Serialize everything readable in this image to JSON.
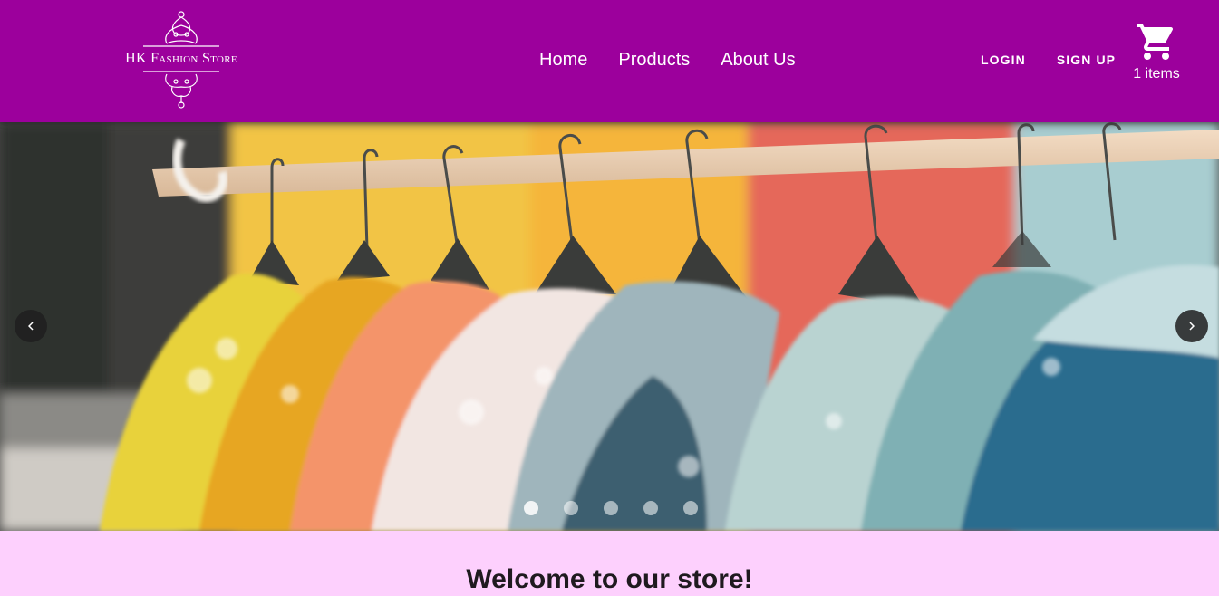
{
  "brand": {
    "name": "HK Fashion Store",
    "logo_icon": "ornament-icon"
  },
  "nav": {
    "items": [
      {
        "label": "Home"
      },
      {
        "label": "Products"
      },
      {
        "label": "About Us"
      }
    ]
  },
  "auth": {
    "login_label": "LOGIN",
    "signup_label": "SIGN UP"
  },
  "cart": {
    "icon": "shopping-cart-icon",
    "count_label": "1 items"
  },
  "carousel": {
    "image": "clothing-rack-jackets",
    "prev_icon": "chevron-left-icon",
    "next_icon": "chevron-right-icon",
    "slides": 5,
    "active_slide": 1
  },
  "welcome": {
    "title": "Welcome to our store!"
  },
  "colors": {
    "header_bg": "#9c009c",
    "section_bg": "#fdd0fd",
    "text_light": "#ffffff"
  }
}
